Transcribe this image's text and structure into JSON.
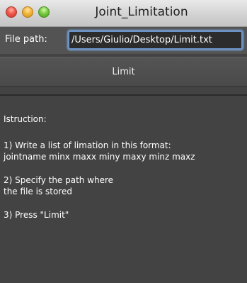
{
  "window": {
    "title": "Joint_Limitation"
  },
  "path_row": {
    "label": "File path:",
    "value": "/Users/Giulio/Desktop/Limit.txt"
  },
  "limit_button": {
    "label": "Limit"
  },
  "instructions": {
    "heading": "Istruction:",
    "step1_line1": "1) Write a list of limation in this format:",
    "step1_line2": "jointname minx maxx miny maxy minz maxz",
    "step2_line1": "2) Specify the path where",
    "step2_line2": "the file is stored",
    "step3_line1": "3) Press \"Limit\""
  },
  "colors": {
    "window_background": "#434343",
    "input_focus_ring": "#6c93c6",
    "close_button": "#f0574b",
    "minimize_button": "#f4b63a",
    "zoom_button": "#77cc3f"
  },
  "icons": {
    "close": "close-icon",
    "minimize": "minimize-icon",
    "zoom": "zoom-icon"
  }
}
